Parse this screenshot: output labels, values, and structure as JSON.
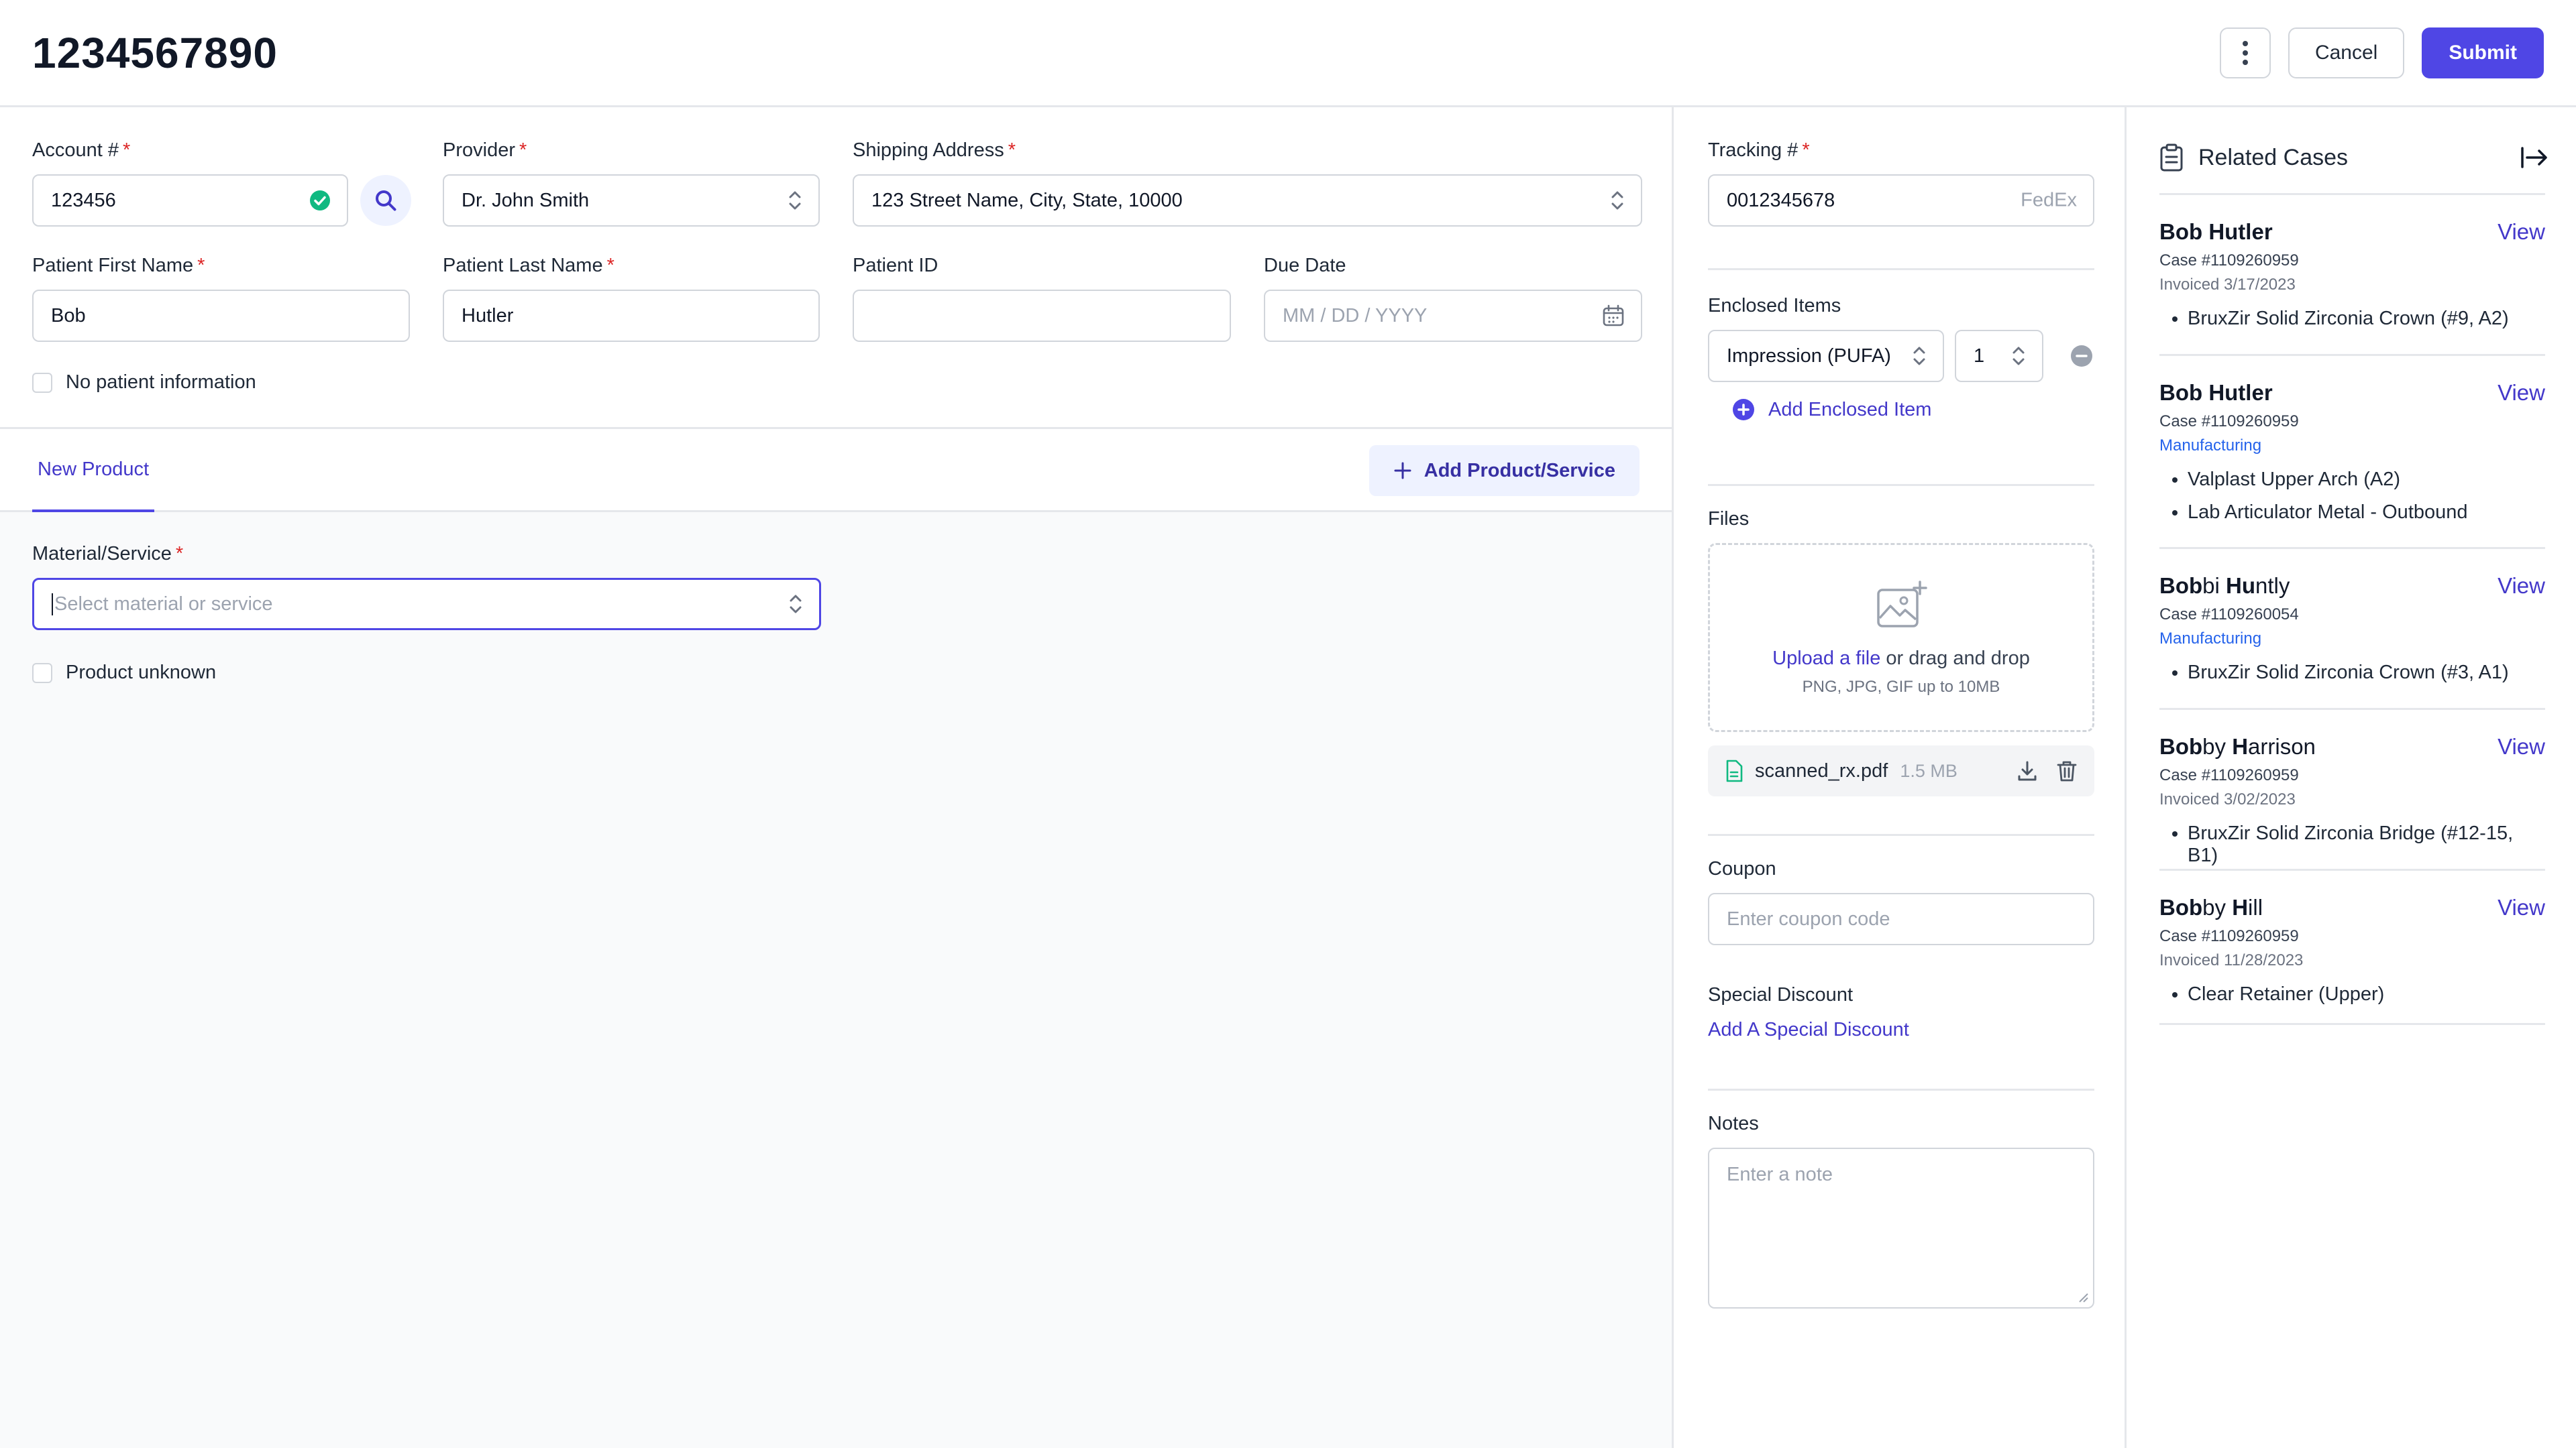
{
  "header": {
    "title": "1234567890",
    "cancel_label": "Cancel",
    "submit_label": "Submit"
  },
  "form": {
    "account": {
      "label": "Account #",
      "value": "123456"
    },
    "provider": {
      "label": "Provider",
      "value": "Dr. John Smith"
    },
    "shipping": {
      "label": "Shipping Address",
      "value": "123 Street Name, City, State, 10000"
    },
    "first_name": {
      "label": "Patient First Name",
      "value": "Bob"
    },
    "last_name": {
      "label": "Patient Last Name",
      "value": "Hutler"
    },
    "patient_id": {
      "label": "Patient ID",
      "value": ""
    },
    "due_date": {
      "label": "Due Date",
      "placeholder": "MM / DD / YYYY"
    },
    "no_patient_label": "No patient information",
    "required_mark": "*"
  },
  "products": {
    "tab_label": "New Product",
    "add_button_label": "Add Product/Service",
    "material_label": "Material/Service",
    "material_placeholder": "Select material or service",
    "product_unknown_label": "Product unknown"
  },
  "side": {
    "tracking": {
      "label": "Tracking #",
      "value": "0012345678",
      "carrier": "FedEx"
    },
    "enclosed": {
      "label": "Enclosed Items",
      "item_value": "Impression (PUFA)",
      "qty_value": "1",
      "add_label": "Add Enclosed Item"
    },
    "files": {
      "label": "Files",
      "upload_link": "Upload a file",
      "upload_rest": "or drag and drop",
      "hint": "PNG, JPG, GIF up to 10MB",
      "file_name": "scanned_rx.pdf",
      "file_size": "1.5 MB"
    },
    "coupon": {
      "label": "Coupon",
      "placeholder": "Enter coupon code"
    },
    "discount": {
      "label": "Special Discount",
      "link": "Add A Special Discount"
    },
    "notes": {
      "label": "Notes",
      "placeholder": "Enter a note"
    }
  },
  "related": {
    "title": "Related Cases",
    "view_label": "View",
    "cases": [
      {
        "name_bold": "Bob Hutler",
        "name_rest": "",
        "case": "Case #1109260959",
        "status": "Invoiced 3/17/2023",
        "status_type": "invoiced",
        "items": [
          "BruxZir Solid Zirconia Crown (#9, A2)"
        ]
      },
      {
        "name_bold": "Bob Hutler",
        "name_rest": "",
        "case": "Case #1109260959",
        "status": "Manufacturing",
        "status_type": "manufacturing",
        "items": [
          "Valplast Upper Arch (A2)",
          "Lab Articulator Metal - Outbound"
        ]
      },
      {
        "name_parts": [
          [
            "Bob",
            true
          ],
          [
            "bi ",
            false
          ],
          [
            "Hu",
            true
          ],
          [
            "ntly",
            false
          ]
        ],
        "case": "Case #1109260054",
        "status": "Manufacturing",
        "status_type": "manufacturing",
        "items": [
          "BruxZir Solid Zirconia Crown (#3, A1)"
        ]
      },
      {
        "name_parts": [
          [
            "Bob",
            true
          ],
          [
            "by ",
            false
          ],
          [
            "H",
            true
          ],
          [
            "arrison",
            false
          ]
        ],
        "case": "Case #1109260959",
        "status": "Invoiced 3/02/2023",
        "status_type": "invoiced",
        "items": [
          "BruxZir Solid Zirconia Bridge (#12-15, B1)"
        ]
      },
      {
        "name_parts": [
          [
            "Bob",
            true
          ],
          [
            "by ",
            false
          ],
          [
            "H",
            true
          ],
          [
            "ill",
            false
          ]
        ],
        "case": "Case #1109260959",
        "status": "Invoiced 11/28/2023",
        "status_type": "invoiced",
        "items": [
          "Clear Retainer (Upper)"
        ]
      }
    ]
  },
  "colors": {
    "accent": "#4f46e5",
    "success": "#10b981",
    "required": "#dc2626",
    "border": "#d1d5db"
  }
}
